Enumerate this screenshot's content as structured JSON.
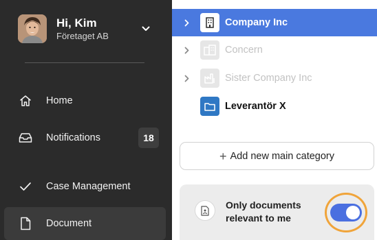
{
  "user": {
    "greeting": "Hi, Kim",
    "company": "Företaget AB"
  },
  "sidebar": {
    "items": [
      {
        "label": "Home",
        "icon": "home-icon"
      },
      {
        "label": "Notifications",
        "icon": "inbox-icon",
        "badge": "18"
      },
      {
        "label": "Case Management",
        "icon": "checkmark-icon"
      },
      {
        "label": "Document",
        "icon": "document-icon"
      }
    ]
  },
  "tree": {
    "items": [
      {
        "label": "Company Inc",
        "icon": "building-icon",
        "selected": true
      },
      {
        "label": "Concern",
        "icon": "office-icon",
        "disabled": true
      },
      {
        "label": "Sister Company Inc",
        "icon": "factory-icon",
        "disabled": true
      },
      {
        "label": "Leverantör X",
        "icon": "folder-icon"
      }
    ]
  },
  "actions": {
    "add_main_category": "Add new main category"
  },
  "preference": {
    "label": "Only documents relevant to me",
    "toggle_on": true
  },
  "colors": {
    "sidebar_bg": "#2b2b2b",
    "accent_blue": "#4a79df",
    "toggle_on": "#4a6fe0",
    "highlight_ring": "#f0a43a"
  }
}
